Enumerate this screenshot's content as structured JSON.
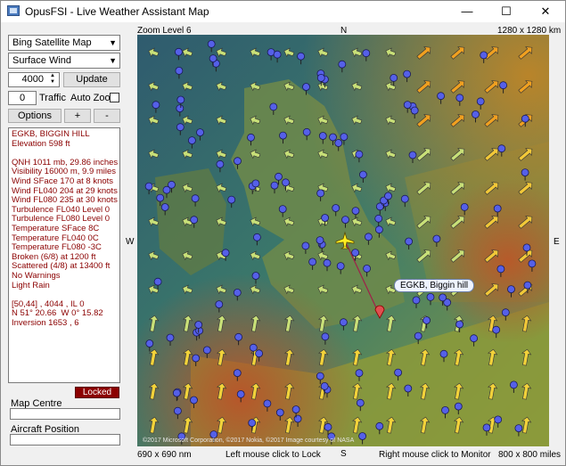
{
  "window": {
    "title": "OpusFSI - Live Weather Assistant Map",
    "minimize": "—",
    "maximize": "☐",
    "close": "✕"
  },
  "controls": {
    "map_type": "Bing Satellite Map",
    "wind_layer": "Surface Wind",
    "altitude": "4000",
    "update_label": "Update",
    "traffic_count": "0",
    "traffic_label": "Traffic",
    "auto_zoom_label": "Auto Zoom",
    "options_label": "Options",
    "zoom_in_label": "+",
    "zoom_out_label": "-"
  },
  "info_lines": [
    "EGKB, BIGGIN HILL",
    "Elevation 598 ft",
    "",
    "QNH 1011 mb, 29.86 inches",
    "Visibility 16000 m, 9.9 miles",
    "Wind SFace 170 at 8 knots",
    "Wind FL040 204 at 29 knots",
    "Wind FL080 235 at 30 knots",
    "Turbulence FL040 Level 0",
    "Turbulence FL080 Level 0",
    "Temperature SFace 8C",
    "Temperature FL040 0C",
    "Temperature FL080 -3C",
    "Broken (6/8) at 1200 ft",
    "Scattered (4/8) at 13400 ft",
    "No Warnings",
    "Light Rain",
    "",
    "[50,44] , 4044 , IL 0",
    "N 51° 20.66  W 0° 15.82",
    "Inversion 1653 , 6"
  ],
  "status": {
    "locked_label": "Locked"
  },
  "fields": {
    "map_centre_label": "Map Centre",
    "map_centre_value": "",
    "aircraft_position_label": "Aircraft Position",
    "aircraft_position_value": ""
  },
  "map": {
    "zoom_label": "Zoom Level 6",
    "size_label": "1280 x 1280 km",
    "north": "N",
    "south": "S",
    "east": "E",
    "west": "W",
    "callout": "EGKB, Biggin hill",
    "copyright": "©2017 Microsoft Corporation, ©2017 Nokia, ©2017 Image courtesy of NASA",
    "bottom_left": "690 x 690 nm",
    "bottom_center_left": "Left mouse click to Lock",
    "bottom_center_right": "Right mouse click to Monitor",
    "bottom_right": "800 x 800 miles"
  }
}
